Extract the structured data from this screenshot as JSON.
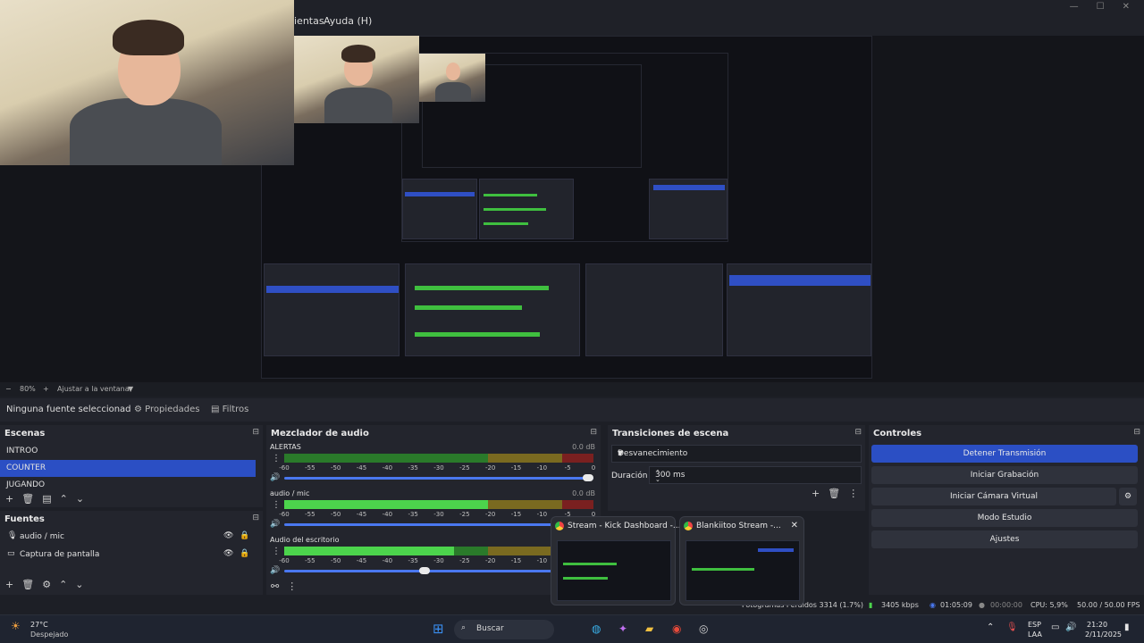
{
  "menu": {
    "items": [
      "ientas",
      "Ayuda (H)"
    ]
  },
  "zoom": {
    "value": "80%",
    "fit_label": "Ajustar a la ventana"
  },
  "source_toolbar": {
    "selected_source": "Ninguna fuente seleccionad",
    "properties_label": "Propiedades",
    "filters_label": "Filtros"
  },
  "scenes": {
    "title": "Escenas",
    "items": [
      {
        "label": "INTROO"
      },
      {
        "label": "COUNTER"
      },
      {
        "label": "JUGANDO"
      }
    ]
  },
  "sources": {
    "title": "Fuentes",
    "items": [
      {
        "label": "audio / mic",
        "icon": "mic-icon"
      },
      {
        "label": "Captura de pantalla",
        "icon": "monitor-icon"
      }
    ]
  },
  "mixer": {
    "title": "Mezclador de audio",
    "scale_ticks": [
      "-60",
      "-55",
      "-50",
      "-45",
      "-40",
      "-35",
      "-30",
      "-25",
      "-20",
      "-15",
      "-10",
      "-5",
      "0"
    ],
    "channels": [
      {
        "name": "ALERTAS",
        "db": "0.0 dB",
        "level": 0.0,
        "volume": 1.0
      },
      {
        "name": "audio / mic",
        "db": "0.0 dB",
        "level": 0.66,
        "volume": 1.0
      },
      {
        "name": "Audio del escritorio",
        "db": "",
        "level": 0.55,
        "volume": 0.47
      }
    ]
  },
  "transitions": {
    "title": "Transiciones de escena",
    "selected": "Desvanecimiento",
    "duration_label": "Duración",
    "duration_value": "300 ms"
  },
  "controls": {
    "title": "Controles",
    "buttons": [
      "Detener Transmisión",
      "Iniciar Grabación",
      "Iniciar Cámara Virtual",
      "Modo Estudio",
      "Ajustes"
    ]
  },
  "status": {
    "frames": "Fotogramas Perdidos 3314 (1.7%)",
    "bitrate": "3405 kbps",
    "stream_time": "01:05:09",
    "rec_time": "00:00:00",
    "cpu": "CPU: 5,9%",
    "fps": "50.00 / 50.00 FPS"
  },
  "taskbar": {
    "weather_temp": "27°C",
    "weather_desc": "Despejado",
    "search_placeholder": "Buscar",
    "lang_top": "ESP",
    "lang_bottom": "LAA",
    "time": "21:20",
    "date": "2/11/2025"
  },
  "previews": [
    {
      "title": "Stream - Kick Dashboard -..."
    },
    {
      "title": "Blankiitoo Stream -..."
    }
  ],
  "colors": {
    "accent": "#2b4fc4",
    "panel": "#23252d",
    "meter_green": "#4cd44c"
  }
}
